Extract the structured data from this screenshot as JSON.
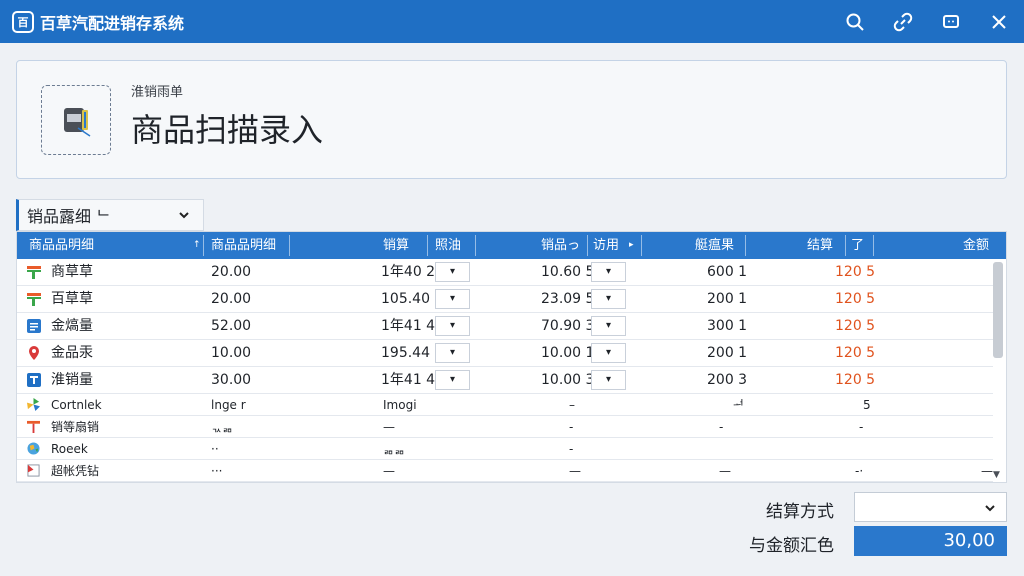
{
  "app": {
    "title": "百草汽配进销存系统",
    "logo_glyph": "百"
  },
  "titlebar_icons": [
    "search-icon",
    "link-icon",
    "chat-icon",
    "close-icon"
  ],
  "header": {
    "subtitle": "淮销雨单",
    "title": "商品扫描录入",
    "scan_icon": "barcode-scanner-icon"
  },
  "section": {
    "label": "销品露细 ᄂ"
  },
  "table": {
    "columns": [
      "商品品明细",
      "商品品明细",
      "销算",
      "照油",
      "销品っ",
      "访用",
      "艇瘟果",
      "结算",
      "了",
      "金额"
    ],
    "rows": [
      {
        "icon_color": "#e95b2a",
        "name": "商草草",
        "c1": "20.00",
        "c2": "1年40 2",
        "c3": "▾",
        "c4": "10.60 5",
        "c5": "▾",
        "c6": "600 1",
        "c7": "120 5"
      },
      {
        "icon_color": "#e95b2a",
        "name": "百草草",
        "c1": "20.00",
        "c2": "105.40 5",
        "c3": "▾",
        "c4": "23.09 5",
        "c5": "▾",
        "c6": "200 1",
        "c7": "120 5"
      },
      {
        "icon_color": "#2a78cc",
        "name": "金熇量",
        "c1": "52.00",
        "c2": "1年41 4",
        "c3": "▾",
        "c4": "70.90 3",
        "c5": "▾",
        "c6": "300 1",
        "c7": "120 5"
      },
      {
        "icon_color": "#d93a3a",
        "name": "金品汞",
        "c1": "10.00",
        "c2": "195.44 5",
        "c3": "▾",
        "c4": "10.00 1",
        "c5": "▾",
        "c6": "200 1",
        "c7": "120 5"
      },
      {
        "icon_color": "#1f6fc4",
        "name": "淮销量",
        "c1": "30.00",
        "c2": "1年41 4",
        "c3": "▾",
        "c4": "10.00 3",
        "c5": "▾",
        "c6": "200 3",
        "c7": "120 5"
      }
    ],
    "small_rows": [
      {
        "name": "Cortnlek",
        "c1": "lnge r",
        "c2": "Imogi",
        "c4": "–",
        "c6": "ᅿ",
        "c7": "5",
        "c9": ""
      },
      {
        "name": "销等扇销",
        "c1": "ᆪᆱ",
        "c2": "—",
        "c4": "-",
        "c6": "-",
        "c7": "-",
        "c9": ""
      },
      {
        "name": "Roeek",
        "c1": "··",
        "c2": "ᆱᆱ",
        "c4": "-",
        "c6": "",
        "c7": "",
        "c9": ""
      },
      {
        "name": "超帐凭钻",
        "c1": "···",
        "c2": "—",
        "c4": "—",
        "c6": "—",
        "c7": "-·",
        "c9": "—"
      }
    ]
  },
  "footer": {
    "pay_label": "结算方式",
    "pay_value": "",
    "total_label": "与金额汇色",
    "total_value": "30,00"
  },
  "colors": {
    "primary": "#1f6fc4",
    "header_row": "#2a78cc",
    "accent": "#e0531e"
  }
}
